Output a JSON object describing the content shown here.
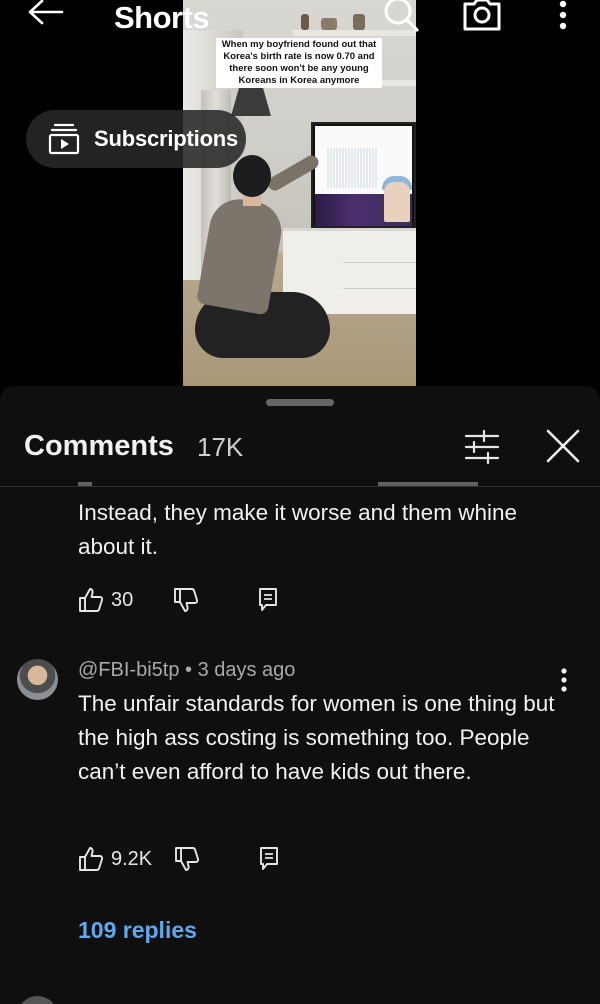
{
  "header": {
    "title": "Shorts",
    "subscriptions_label": "Subscriptions"
  },
  "video": {
    "caption": "When my boyfriend found out that Korea's birth rate is now 0.70 and there soon won't be any young Koreans in Korea anymore"
  },
  "comments": {
    "title": "Comments",
    "count": "17K",
    "items": [
      {
        "text": "Instead, they make it worse and them whine about it.",
        "likes": "30"
      },
      {
        "author": "@FBI-bi5tp",
        "time": "3 days ago",
        "text": "The unfair standards for women is one thing but the high ass costing is something too. People can’t even afford to have kids out there.",
        "likes": "9.2K",
        "replies": "109 replies"
      }
    ]
  },
  "colors": {
    "background": "#000000",
    "sheet": "#0f0f0f",
    "link": "#5ea8ef"
  },
  "icons": [
    "back-arrow-icon",
    "search-icon",
    "camera-icon",
    "more-vertical-icon",
    "subscriptions-icon",
    "filter-icon",
    "close-icon",
    "thumbs-up-icon",
    "thumbs-down-icon",
    "reply-icon"
  ]
}
